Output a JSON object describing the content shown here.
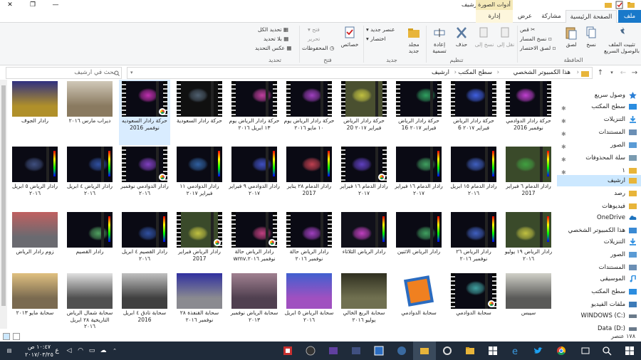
{
  "window": {
    "title": "ارشيف",
    "context_tools": "أدوات الصورة",
    "minimize": "—",
    "maximize": "❐",
    "close": "✕"
  },
  "tabs": {
    "file": "ملف",
    "home": "الصفحة الرئيسية",
    "share": "مشاركة",
    "view": "عرض",
    "manage": "إدارة"
  },
  "ribbon": {
    "clipboard": {
      "label": "الحافظة",
      "pin": "تثبيت الملف بالوصول السريع",
      "copy": "نسخ",
      "paste": "لصق",
      "cut": "قص",
      "copy_path": "نسخ المسار",
      "paste_shortcut": "لصق الاختصار"
    },
    "organize": {
      "label": "تنظيم",
      "move_to": "نقل إلى",
      "copy_to": "نسخ إلى",
      "delete": "حذف",
      "rename": "إعادة تسمية"
    },
    "new": {
      "label": "جديد",
      "new_folder": "مجلد جديد",
      "new_item": "عنصر جديد",
      "easy_access": "اختصار"
    },
    "open": {
      "label": "فتح",
      "properties": "خصائص",
      "open": "فتح",
      "edit": "تحرير",
      "history": "المحفوظات"
    },
    "select": {
      "label": "تحديد",
      "select_all": "تحديد الكل",
      "select_none": "بلا تحديد",
      "invert": "عكس التحديد"
    }
  },
  "address": {
    "crumbs": [
      "هذا الكمبيوتر الشخصي",
      "سطح المكتب",
      "ارشيف"
    ],
    "search_placeholder": "بحث في ارشيف"
  },
  "nav": [
    {
      "label": "وصول سريع",
      "icon": "star-icon",
      "color": "#2b7fd6",
      "pin": false
    },
    {
      "label": "سطح المكتب",
      "icon": "desktop-icon",
      "color": "#2b8de0",
      "pin": true
    },
    {
      "label": "التنزيلات",
      "icon": "download-icon",
      "color": "#2b8de0",
      "pin": true
    },
    {
      "label": "المستندات",
      "icon": "documents-icon",
      "color": "#6b8fb5",
      "pin": true
    },
    {
      "label": "الصور",
      "icon": "pictures-icon",
      "color": "#5a9bd5",
      "pin": true
    },
    {
      "label": "سلة المحذوفات",
      "icon": "recycle-bin-icon",
      "color": "#7a9bb0",
      "pin": true
    },
    {
      "label": "١",
      "icon": "folder-icon",
      "color": "#e8b53a",
      "pin": true
    },
    {
      "label": "ارشيف",
      "icon": "folder-icon",
      "color": "#e8b53a",
      "pin": false,
      "selected": true
    },
    {
      "label": "رصد",
      "icon": "folder-icon",
      "color": "#e8b53a",
      "pin": false
    },
    {
      "label": "فيديوهات",
      "icon": "folder-icon",
      "color": "#e8b53a",
      "pin": false
    },
    {
      "label": "OneDrive",
      "icon": "onedrive-icon",
      "color": "#1e73be",
      "pin": false
    },
    {
      "label": "هذا الكمبيوتر الشخصي",
      "icon": "computer-icon",
      "color": "#3a8ad4",
      "pin": false
    },
    {
      "label": "التنزيلات",
      "icon": "download-icon",
      "color": "#2b8de0",
      "pin": false
    },
    {
      "label": "الصور",
      "icon": "pictures-icon",
      "color": "#5a9bd5",
      "pin": false
    },
    {
      "label": "المستندات",
      "icon": "documents-icon",
      "color": "#6b8fb5",
      "pin": false
    },
    {
      "label": "الموسيقى",
      "icon": "music-icon",
      "color": "#2b8de0",
      "pin": false
    },
    {
      "label": "سطح المكتب",
      "icon": "desktop-icon",
      "color": "#2b8de0",
      "pin": false
    },
    {
      "label": "ملفات الفيديو",
      "icon": "video-icon",
      "color": "#3d7bb8",
      "pin": false
    },
    {
      "label": "WINDOWS (C:)",
      "icon": "drive-c-icon",
      "color": "#6a7a8a",
      "pin": false
    },
    {
      "label": "Data (D:)",
      "icon": "drive-d-icon",
      "color": "#6a7a8a",
      "pin": false
    }
  ],
  "files": [
    [
      {
        "label": "حركة رادار الدوادمي نوفمبر 2016",
        "type": "video",
        "bg": "#0a0a14",
        "accent": "#c040d0"
      },
      {
        "label": "حركة رادار الرياض فبراير ٢٠١٧ 6",
        "type": "video",
        "bg": "#0a0a14",
        "accent": "#4060e0"
      },
      {
        "label": "حركة رادار الرياض فبراير ٢٠١٧ 16",
        "type": "video",
        "bg": "#0a0a14",
        "accent": "#30a060"
      },
      {
        "label": "حركة رادار الرياض فبراير ٢٠١٧ 20",
        "type": "video",
        "bg": "#4a5030",
        "accent": "#c0c040"
      },
      {
        "label": "حركة رادار الرياض يوم ١٠ مايو ٢٠١٦",
        "type": "video",
        "bg": "#0a0a14",
        "accent": "#a040c0"
      },
      {
        "label": "حركة رادار الرياض يوم ١٣ ابريل ٢٠١٦",
        "type": "video",
        "bg": "#0a0a14",
        "accent": "#c040a0"
      },
      {
        "label": "حركة رادار السعودية",
        "type": "video",
        "bg": "#101010",
        "accent": "#506070"
      },
      {
        "label": "حركة رادار السعوديه نوفمبر 2016",
        "type": "chrome",
        "bg": "#0a0a14",
        "accent": "#c030b0",
        "selected": true
      },
      {
        "label": "ديراب مارس ٢٠١٦",
        "type": "photo",
        "bg": "#8a7a60",
        "accent": "#d0c8b8"
      },
      {
        "label": "رادار الجوف",
        "type": "photo",
        "bg": "#b0902a",
        "accent": "#303080"
      }
    ],
    [
      {
        "label": "رادار الدمام ٦ فبراير 2017",
        "type": "image",
        "bg": "#3a4a2a",
        "accent": "#40a040"
      },
      {
        "label": "رادار الدمام ١٥ ابريل ٢٠١٦",
        "type": "image",
        "bg": "#0a0a14",
        "accent": "#4060c0"
      },
      {
        "label": "رادار الدمام ١٦ فبراير ٢٠١٧",
        "type": "image",
        "bg": "#0a0a14",
        "accent": "#40a060"
      },
      {
        "label": "رادار الدمام ١٦ فبراير ٢٠١٧",
        "type": "chrome",
        "bg": "#0a0a14",
        "accent": "#6040c0"
      },
      {
        "label": "رادار الدمام ٢٨ يناير 2017",
        "type": "image",
        "bg": "#0a0a14",
        "accent": "#c04050"
      },
      {
        "label": "رادار الدوادمي ٩ فبراير ٢٠١٧",
        "type": "image",
        "bg": "#0a0a14",
        "accent": "#4050c0"
      },
      {
        "label": "رادار الدوادمي ١١ فبراير ٢٠١٧",
        "type": "image",
        "bg": "#0a0a14",
        "accent": "#3060a0"
      },
      {
        "label": "رادار الدوادمي نوفمبر ٢٠١٦",
        "type": "chrome",
        "bg": "#0a0a14",
        "accent": "#8040c0"
      },
      {
        "label": "رادار الرياض ٤ ابريل ٢٠١٦",
        "type": "image",
        "bg": "#0a0a14",
        "accent": "#3050a0"
      },
      {
        "label": "رادار الرياض ٥ ابريل ٢٠١٦",
        "type": "image",
        "bg": "#0a0a14",
        "accent": "#405080"
      }
    ],
    [
      {
        "label": "رادار الرياض ١٩ يوليو ٢٠١٦",
        "type": "image",
        "bg": "#3a4a2a",
        "accent": "#c0c040"
      },
      {
        "label": "رادار الرياض ٢٦ نوفمبر ٢٠١٦",
        "type": "image",
        "bg": "#0a0a14",
        "accent": "#4060c0"
      },
      {
        "label": "رادار الرياض الاثنين",
        "type": "image",
        "bg": "#0a0a14",
        "accent": "#40a060"
      },
      {
        "label": "رادار الرياض الثلاثاء",
        "type": "image",
        "bg": "#10101a",
        "accent": "#c040c0"
      },
      {
        "label": "رادار الرياض حالة نوفمبر ٢٠١٦",
        "type": "video",
        "bg": "#0a0a14",
        "accent": "#a040c0"
      },
      {
        "label": "رادار الرياض حالة نوفمبر ٢٠١٦.wmv",
        "type": "chrome",
        "bg": "#0a0a14",
        "accent": "#c04080"
      },
      {
        "label": "رادار الرياض فبراير 2017",
        "type": "chrome",
        "bg": "#3a4a2a",
        "accent": "#c0c040"
      },
      {
        "label": "رادار القصيم ٤ ابريل ٢٠١٦",
        "type": "image",
        "bg": "#0a0a14",
        "accent": "#3050a0"
      },
      {
        "label": "رادار القصيم",
        "type": "image",
        "bg": "#0a0a14",
        "accent": "#50a060"
      },
      {
        "label": "زوم رادار الرياض",
        "type": "photo",
        "bg": "#6a6a70",
        "accent": "#c06060"
      }
    ],
    [
      {
        "label": "سيبس",
        "type": "photo",
        "bg": "#5a5a58",
        "accent": "#d0d0c8"
      },
      {
        "label": "سحابة الدوادمي",
        "type": "chrome",
        "bg": "#0a0a14",
        "accent": "#40a0a0"
      },
      {
        "label": "سحابة الدوادمي",
        "type": "movie",
        "bg": "#ffffff",
        "accent": "#f08020"
      },
      {
        "label": "سحابة الربع الخالي يوليو ٢٠١٦",
        "type": "photo",
        "bg": "#707050",
        "accent": "#303020"
      },
      {
        "label": "سحابة الرياض ٥ ابريل ٢٠١٦",
        "type": "photo",
        "bg": "#a050c0",
        "accent": "#4060d0"
      },
      {
        "label": "سحابة الرياض نوفمبر ٢٠١٣",
        "type": "photo",
        "bg": "#504050",
        "accent": "#a08090"
      },
      {
        "label": "سحابة القنفذة ٢٨ نوفمبر ٢٠١٦",
        "type": "photo",
        "bg": "#8a8a90",
        "accent": "#3030a0"
      },
      {
        "label": "سحابة تادق ٤ ابريل 2016",
        "type": "photo",
        "bg": "#404040",
        "accent": "#c0c0c0"
      },
      {
        "label": "سحابة شمال الرياض التاريخية ٢٨ ابريل ٢٠١٦",
        "type": "photo",
        "bg": "#505050",
        "accent": "#e0e0e0"
      },
      {
        "label": "سحابة مايو ٢٠١٣",
        "type": "photo",
        "bg": "#7a6a50",
        "accent": "#e0c080"
      }
    ]
  ],
  "status": {
    "count": "١٧٨ عنصر"
  },
  "taskbar": {
    "time": "١٠:٤٧ ص",
    "date": "٢٠١٧/٠٣/٢٥",
    "lang": "ع"
  }
}
